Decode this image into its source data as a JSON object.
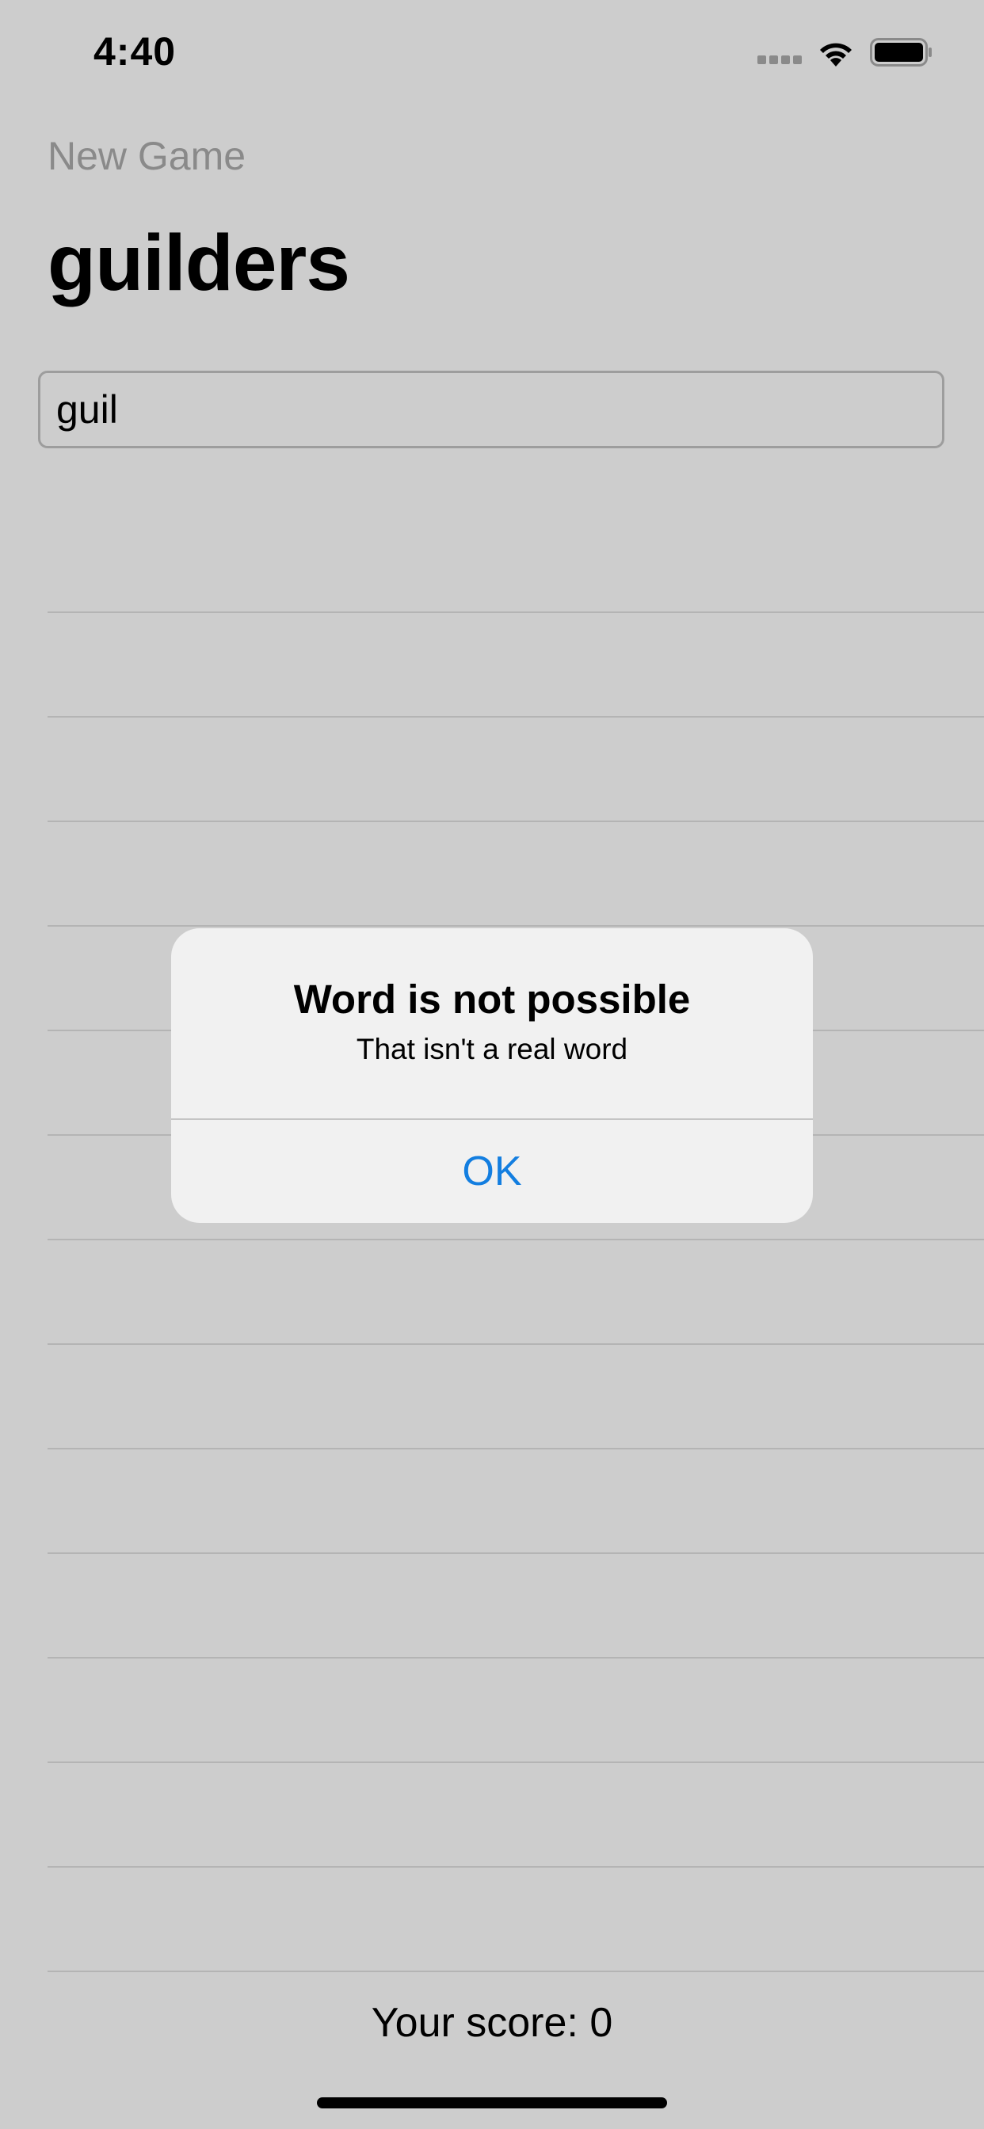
{
  "status_bar": {
    "time": "4:40",
    "icons": [
      "signal-icon",
      "wifi-icon",
      "battery-icon"
    ]
  },
  "nav": {
    "new_game_label": "New Game",
    "root_word": "guilders"
  },
  "input": {
    "value": "guil"
  },
  "word_list": {
    "rows": 14,
    "entries": []
  },
  "alert": {
    "title": "Word is not possible",
    "message": "That isn't a real word",
    "ok_label": "OK",
    "accent_color": "#137ee0"
  },
  "footer": {
    "score_text": "Your score: 0"
  },
  "colors": {
    "background": "#cdcdcd",
    "alert_background": "#f1f1f1",
    "disabled_text": "#8a8a8a"
  }
}
